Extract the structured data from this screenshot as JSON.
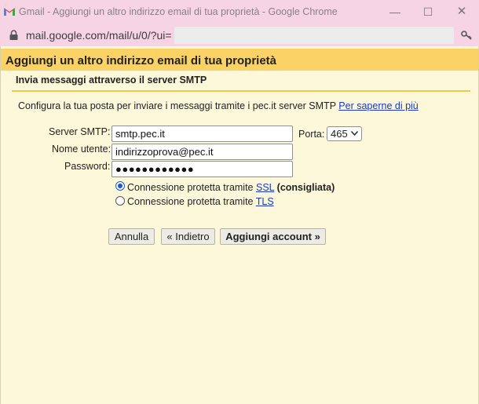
{
  "window": {
    "title": "Gmail - Aggiungi un altro indirizzo email di tua proprietà - Google Chrome",
    "url": "mail.google.com/mail/u/0/?ui=",
    "minimize_glyph": "—",
    "maximize_glyph": "☐",
    "close_glyph": "✕"
  },
  "dialog": {
    "title": "Aggiungi un altro indirizzo email di tua proprietà",
    "section": "Invia messaggi attraverso il server SMTP",
    "intro_text": "Configura la tua posta per inviare i messaggi tramite i pec.it server SMTP",
    "learn_more": "Per saperne di più",
    "labels": {
      "smtp": "Server SMTP:",
      "username": "Nome utente:",
      "password": "Password:",
      "port": "Porta:"
    },
    "values": {
      "smtp": "smtp.pec.it",
      "username": "indirizzoprova@pec.it",
      "password": "●●●●●●●●●●●●",
      "port": "465"
    },
    "security": {
      "prefix": "Connessione protetta tramite",
      "ssl_label": "SSL",
      "ssl_note": "(consigliata)",
      "tls_label": "TLS",
      "selected": "SSL"
    },
    "buttons": {
      "cancel": "Annulla",
      "back": "« Indietro",
      "add": "Aggiungi account »"
    }
  },
  "colors": {
    "titlebar": "#f7d4e4",
    "header_band": "#fad266",
    "background": "#fdf8d9",
    "link": "#1a39c6",
    "radio_selected": "#1a56d6"
  },
  "icons": {
    "app": "gmail-icon",
    "security": "lock-icon",
    "extension": "key-icon",
    "dropdown": "chevron-down-icon"
  }
}
